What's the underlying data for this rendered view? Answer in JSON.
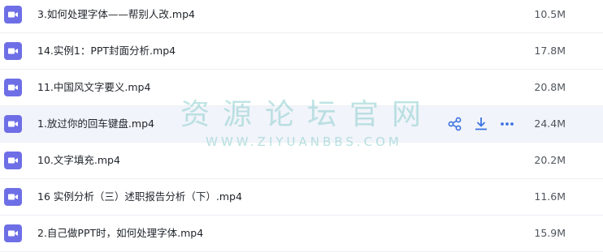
{
  "files": [
    {
      "name": "3.如何处理字体——帮别人改.mp4",
      "size": "10.5M",
      "icon": "video-file-icon"
    },
    {
      "name": "14.实例1：PPT封面分析.mp4",
      "size": "17.8M",
      "icon": "video-file-icon"
    },
    {
      "name": "11.中国风文字要义.mp4",
      "size": "20.8M",
      "icon": "video-file-icon"
    },
    {
      "name": "1.放过你的回车键盘.mp4",
      "size": "24.4M",
      "icon": "video-file-icon"
    },
    {
      "name": "10.文字填充.mp4",
      "size": "20.2M",
      "icon": "video-file-icon"
    },
    {
      "name": "16 实例分析（三）述职报告分析（下）.mp4",
      "size": "11.6M",
      "icon": "video-file-icon"
    },
    {
      "name": "2.自己做PPT时，如何处理字体.mp4",
      "size": "15.9M",
      "icon": "video-file-icon"
    }
  ],
  "hover_actions": [
    "share-icon",
    "download-icon",
    "more-icon"
  ],
  "watermark": {
    "title": "资源论坛官网",
    "url": "WWW.ZIYUANBBS.COM"
  },
  "colors": {
    "icon_bg": "#6e6fe6",
    "action_blue": "#3b73e0",
    "hover_row_bg": "#f1f4fa",
    "divider": "#eef0f4"
  }
}
